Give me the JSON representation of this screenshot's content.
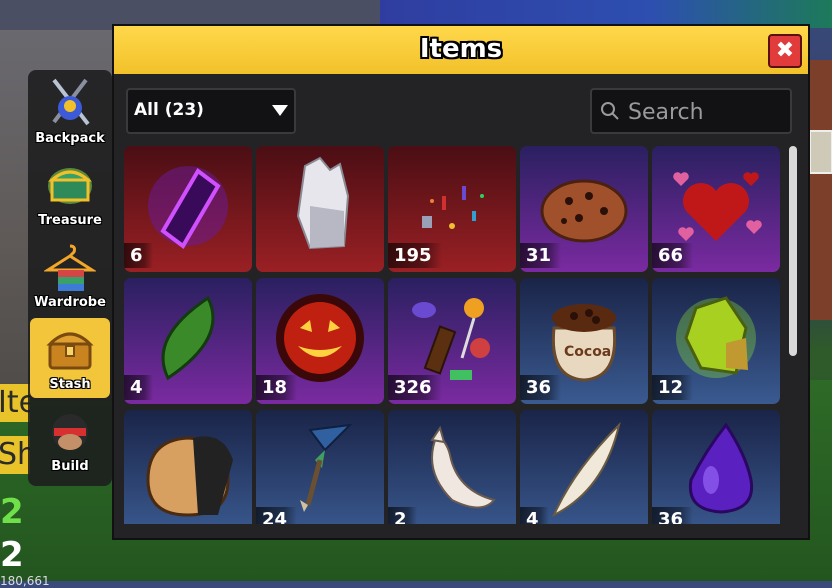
{
  "window": {
    "title": "Items",
    "close_glyph": "✖"
  },
  "filter": {
    "selected": "All (23)"
  },
  "search": {
    "placeholder": "Search",
    "value": ""
  },
  "dock": {
    "items": [
      {
        "label": "Backpack",
        "icon": "backpack-swords-icon",
        "active": false
      },
      {
        "label": "Treasure",
        "icon": "treasure-chest-icon",
        "active": false
      },
      {
        "label": "Wardrobe",
        "icon": "wardrobe-hanger-icon",
        "active": false
      },
      {
        "label": "Stash",
        "icon": "stash-chest-icon",
        "active": true
      },
      {
        "label": "Build",
        "icon": "build-avatar-icon",
        "active": false
      }
    ]
  },
  "side_hud": {
    "tag1": "Ite",
    "tag2": "Sh",
    "stat_green": "2",
    "stat_white": "2",
    "stat_small": "180,661"
  },
  "items": [
    {
      "qty": "6",
      "icon": "purple-crystal-icon",
      "theme": "red"
    },
    {
      "qty": "",
      "icon": "white-crystal-icon",
      "theme": "red"
    },
    {
      "qty": "195",
      "icon": "confetti-icon",
      "theme": "red"
    },
    {
      "qty": "31",
      "icon": "cookie-icon",
      "theme": "purple"
    },
    {
      "qty": "66",
      "icon": "hearts-icon",
      "theme": "purple"
    },
    {
      "qty": "4",
      "icon": "green-leaf-icon",
      "theme": "purple"
    },
    {
      "qty": "18",
      "icon": "jack-o-lantern-icon",
      "theme": "purple"
    },
    {
      "qty": "326",
      "icon": "candy-icon",
      "theme": "purple"
    },
    {
      "qty": "36",
      "icon": "cocoa-sack-icon",
      "theme": "blue"
    },
    {
      "qty": "12",
      "icon": "green-ore-icon",
      "theme": "blue"
    },
    {
      "qty": "",
      "icon": "sack-icon",
      "theme": "blue"
    },
    {
      "qty": "24",
      "icon": "fish-tail-icon",
      "theme": "blue"
    },
    {
      "qty": "2",
      "icon": "white-fang-icon",
      "theme": "blue"
    },
    {
      "qty": "4",
      "icon": "large-fang-icon",
      "theme": "blue"
    },
    {
      "qty": "36",
      "icon": "purple-drop-icon",
      "theme": "blue"
    }
  ],
  "colors": {
    "title_bar": "#f2c12a",
    "close_button": "#e23b3b",
    "active_tab": "#f2c53a",
    "tile_red": "#8a1e22",
    "tile_purple": "#6a2a8a",
    "tile_blue": "#2f4f82"
  }
}
